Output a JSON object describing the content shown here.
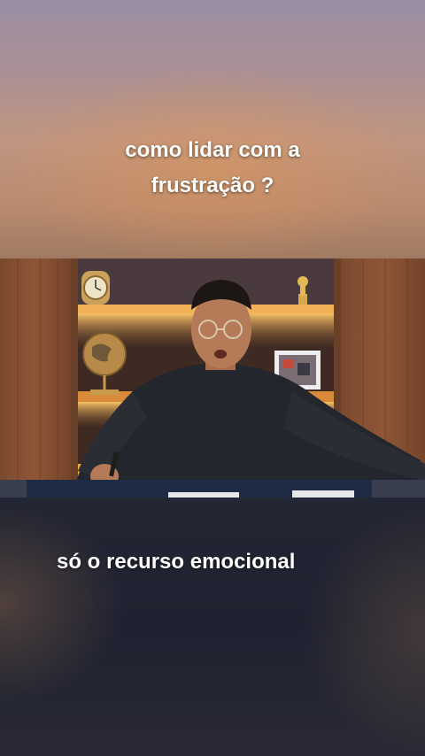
{
  "captions": {
    "top_line1": "como lidar com a",
    "top_line2": "frustração ?",
    "subtitle": "só o recurso emocional"
  },
  "colors": {
    "caption_text": "#ffffff",
    "top_gradient_start": "#9a8ea4",
    "top_gradient_end": "#a07a62",
    "bottom_background": "#1f2230",
    "wood_panel": "#8a5234",
    "shelf_light": "#f2b057",
    "sweater": "#23262c"
  },
  "icons": {
    "clock": "desk-clock-icon",
    "globe": "globe-icon",
    "trophy": "trophy-icon"
  }
}
